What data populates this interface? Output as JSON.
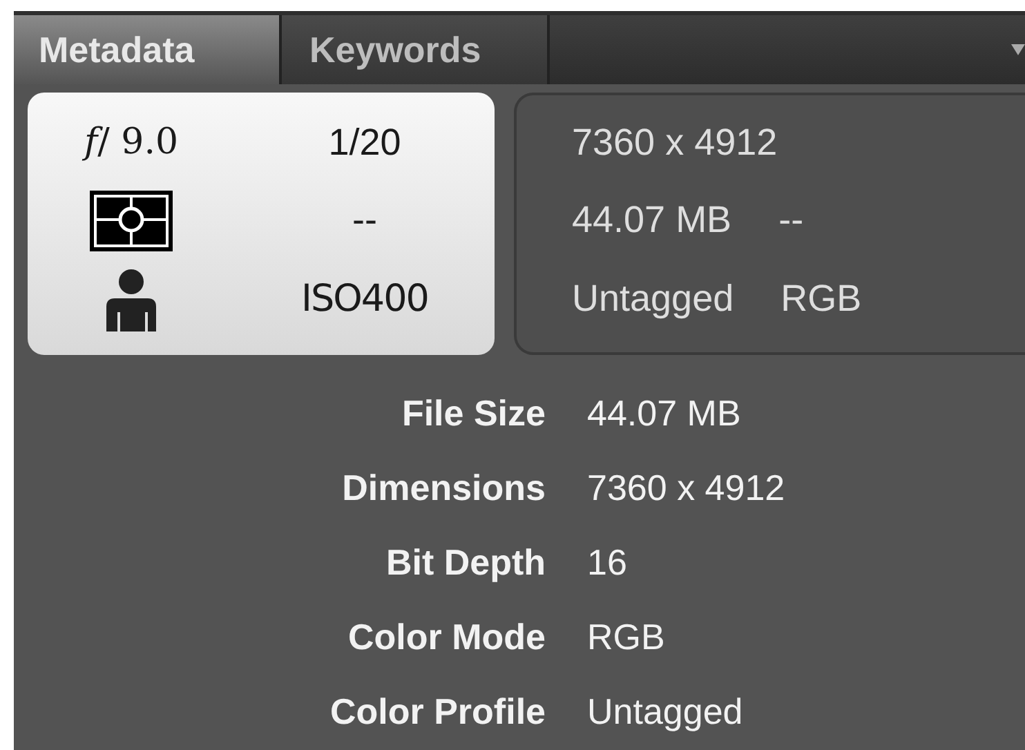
{
  "tabs": [
    {
      "label": "Metadata",
      "selected": true
    },
    {
      "label": "Keywords",
      "selected": false
    }
  ],
  "camera": {
    "aperture": "*f*/ 9.0",
    "shutter": "1/20",
    "metering": "--",
    "iso": "ISO400"
  },
  "summary": {
    "dimensions": "7360 x 4912",
    "size": "44.07 MB",
    "extra": "--",
    "profile": "Untagged",
    "mode": "RGB"
  },
  "fields": [
    {
      "label": "File Size",
      "value": "44.07 MB"
    },
    {
      "label": "Dimensions",
      "value": "7360 x 4912"
    },
    {
      "label": "Bit Depth",
      "value": "16"
    },
    {
      "label": "Color Mode",
      "value": "RGB"
    },
    {
      "label": "Color Profile",
      "value": "Untagged"
    }
  ]
}
